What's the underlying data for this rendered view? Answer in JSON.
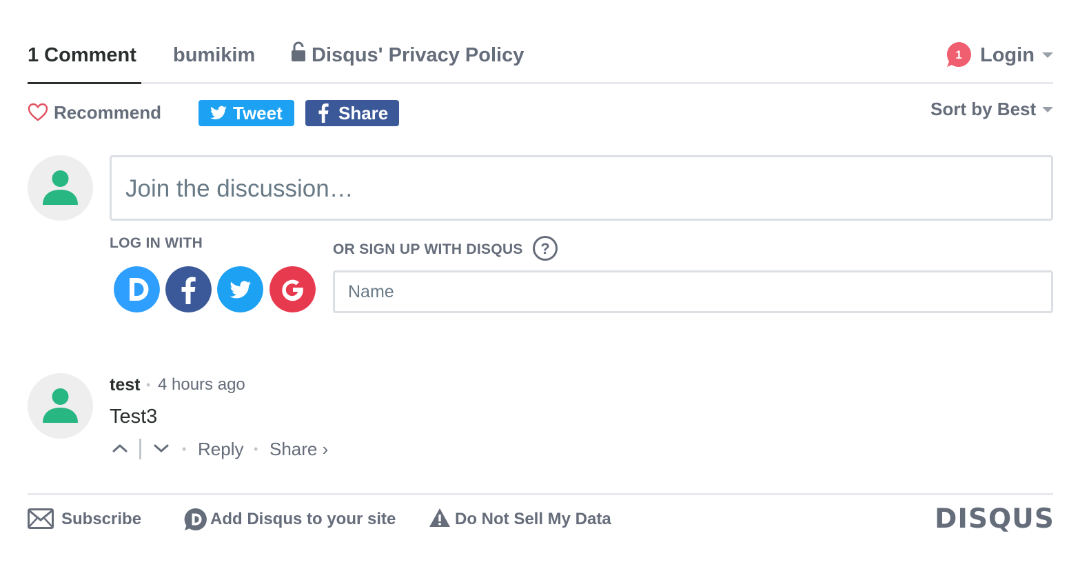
{
  "nav": {
    "tabs": [
      {
        "label": "1 Comment",
        "active": true
      },
      {
        "label": "bumikim"
      },
      {
        "label": "Disqus' Privacy Policy",
        "icon": "lock-icon"
      }
    ],
    "notification_count": "1",
    "login_label": "Login"
  },
  "actions": {
    "recommend_label": "Recommend",
    "tweet_label": "Tweet",
    "share_label": "Share",
    "sort_label": "Sort by Best"
  },
  "compose": {
    "placeholder": "Join the discussion…",
    "login_with_label": "LOG IN WITH",
    "signup_label": "OR SIGN UP WITH DISQUS",
    "help_glyph": "?",
    "name_placeholder": "Name",
    "social_providers": [
      "disqus-icon",
      "facebook-icon",
      "twitter-icon",
      "google-icon"
    ]
  },
  "comment": {
    "author": "test",
    "separator": "•",
    "time": "4 hours ago",
    "body": "Test3",
    "reply_label": "Reply",
    "share_label": "Share ›"
  },
  "footer": {
    "subscribe_label": "Subscribe",
    "add_disqus_label": "Add Disqus to your site",
    "do_not_sell_label": "Do Not Sell My Data",
    "logo_text": "DISQUS"
  },
  "colors": {
    "text_primary": "#2a2e2e",
    "text_muted": "#656c7a",
    "twitter_blue": "#1da1f2",
    "facebook_blue": "#3b5998",
    "disqus_blue": "#2e9fff",
    "google_red": "#e83a4f",
    "notification_red": "#f05f70",
    "avatar_green": "#28b683",
    "heart_red": "#e0515f",
    "border_gray": "#dbdfe4"
  }
}
